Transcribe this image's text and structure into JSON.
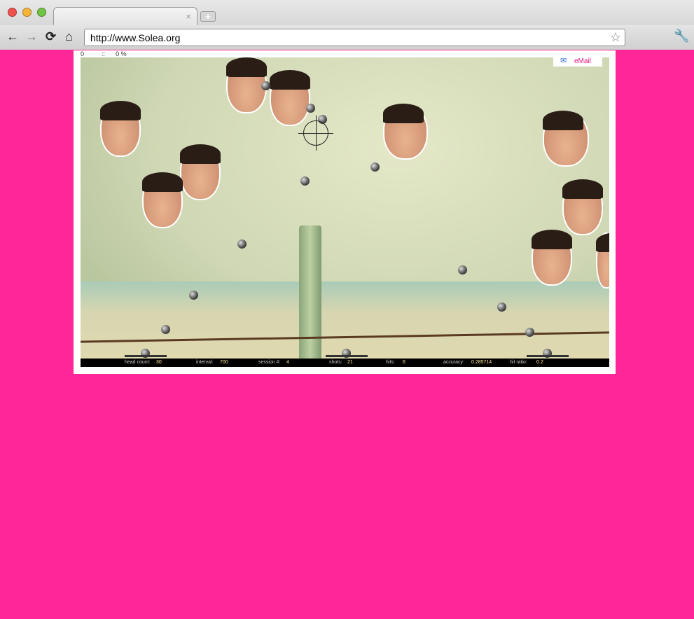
{
  "browser": {
    "url": "http://www.Solea.org",
    "tab_close": "×",
    "new_tab": "+",
    "back": "←",
    "forward": "→",
    "reload": "⟳",
    "home": "⌂",
    "bookmark": "☆",
    "wrench": "🔧"
  },
  "page": {
    "loader": {
      "count": "0",
      "sep": "::",
      "percent": "0 %"
    },
    "email_label": "eMail",
    "status": {
      "head_count_label": "head count:",
      "head_count": "30",
      "interval_label": "interval:",
      "interval": "700",
      "session_label": "session #:",
      "session": "4",
      "shots_label": "shots:",
      "shots": "21",
      "hits_label": "hits:",
      "hits": "6",
      "accuracy_label": "accuracy:",
      "accuracy": "0.285714",
      "hit_ratio_label": "hit ratio:",
      "hit_ratio": "0.2"
    }
  },
  "colors": {
    "background": "#ff2699",
    "email": "#e0147f"
  }
}
